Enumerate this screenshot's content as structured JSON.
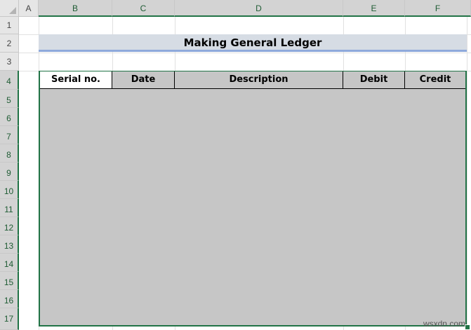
{
  "sheet": {
    "columns": [
      "A",
      "B",
      "C",
      "D",
      "E",
      "F"
    ],
    "rows": [
      "1",
      "2",
      "3",
      "4",
      "5",
      "6",
      "7",
      "8",
      "9",
      "10",
      "11",
      "12",
      "13",
      "14",
      "15",
      "16",
      "17"
    ]
  },
  "title": "Making General Ledger",
  "table_headers": [
    "Serial no.",
    "Date",
    "Description",
    "Debit",
    "Credit"
  ],
  "watermark": "wsxdn.com",
  "colors": {
    "accent": "#217346",
    "range_fill": "#c6c6c6",
    "title_fill": "#d6dce4",
    "title_border": "#8ea9db"
  }
}
